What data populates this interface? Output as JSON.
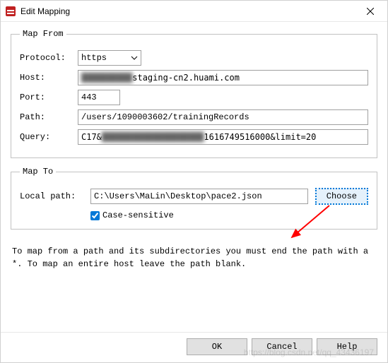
{
  "window": {
    "title": "Edit Mapping"
  },
  "mapFrom": {
    "legend": "Map From",
    "protocolLabel": "Protocol:",
    "protocol": "https",
    "hostLabel": "Host:",
    "hostObscured": "██████████",
    "hostVisible": "staging-cn2.huami.com",
    "portLabel": "Port:",
    "port": "443",
    "pathLabel": "Path:",
    "path": "/users/1090003602/trainingRecords",
    "queryLabel": "Query:",
    "queryPrefix": "C17&",
    "queryObscured": "████████████████████",
    "querySuffix": "1616749516000&limit=20"
  },
  "mapTo": {
    "legend": "Map To",
    "localPathLabel": "Local path:",
    "localPath": "C:\\Users\\MaLin\\Desktop\\pace2.json",
    "chooseLabel": "Choose",
    "caseSensitiveLabel": "Case-sensitive",
    "caseSensitiveChecked": true
  },
  "hint": "To map from a path and its subdirectories you must end the path with a *. To map an entire host leave the path blank.",
  "buttons": {
    "ok": "OK",
    "cancel": "Cancel",
    "help": "Help"
  },
  "watermark": "https://blog.csdn.net/qq_43436197"
}
